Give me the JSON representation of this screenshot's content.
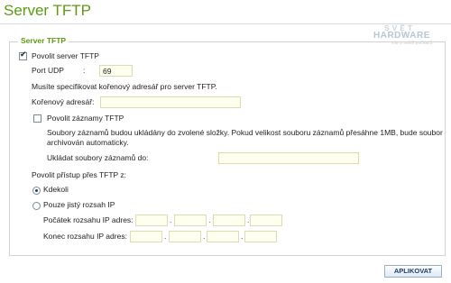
{
  "header": {
    "title": "Server TFTP"
  },
  "watermark": {
    "line1": "SVĚT",
    "line2": "HARDWARE",
    "line3": "vše o světě počítačů"
  },
  "section": {
    "legend": "Server TFTP"
  },
  "enable": {
    "label": "Povolit server TFTP",
    "checked": true
  },
  "port": {
    "label": "Port UDP",
    "colon": ":",
    "value": "69"
  },
  "root": {
    "note": "Musíte specifikovat kořenový adresář pro server TFTP.",
    "label": "Kořenový adresář:",
    "value": ""
  },
  "logs": {
    "label": "Povolit záznamy TFTP",
    "checked": false,
    "note": "Soubory záznamů budou ukládány do zvolené složky. Pokud velikost souboru záznamů přesáhne 1MB, bude soubor archivován automaticky.",
    "folder_label": "Ukládat soubory záznamů do:",
    "folder_value": ""
  },
  "access": {
    "label": "Povolit přístup přes TFTP z:",
    "option_any": "Kdekoli",
    "option_range": "Pouze jistý rozsah IP",
    "selected": "any",
    "start_label": "Počátek rozsahu IP adres:",
    "end_label": "Konec rozsahu IP adres:",
    "start_ip": [
      "",
      "",
      "",
      ""
    ],
    "end_ip": [
      "",
      "",
      "",
      ""
    ]
  },
  "actions": {
    "apply_label": "APLIKOVAT"
  }
}
